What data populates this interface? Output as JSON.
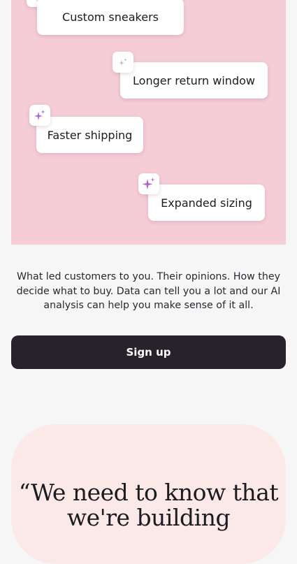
{
  "hero": {
    "chips": [
      {
        "label": "Custom sneakers"
      },
      {
        "label": "Longer return window"
      },
      {
        "label": "Faster shipping"
      },
      {
        "label": "Expanded sizing"
      }
    ],
    "icon": "sparkle-icon",
    "background": "#f5cdd6",
    "sparkle_color": "#b464c8"
  },
  "description": "What led customers to you. Their opinions. How they decide what to buy. Data can tell you a lot and our AI analysis can help you make sense of it all.",
  "signup": {
    "label": "Sign up"
  },
  "quote": {
    "text": "“We need to know that we're building"
  }
}
